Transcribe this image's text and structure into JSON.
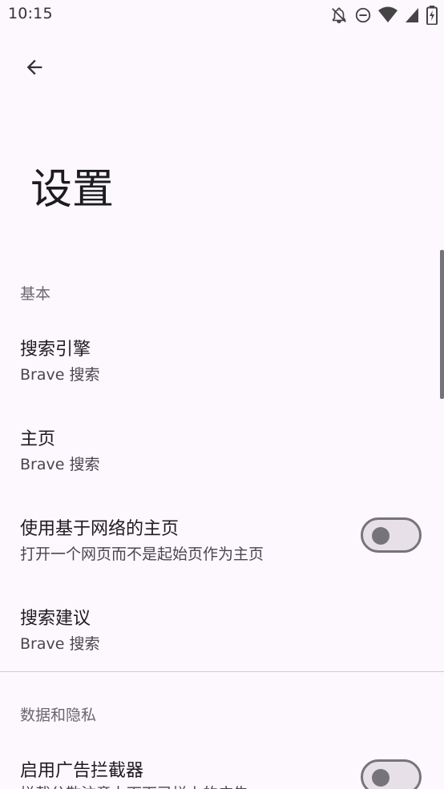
{
  "status_bar": {
    "time": "10:15",
    "icons": [
      "bell-off-icon",
      "do-not-disturb-icon",
      "wifi-icon",
      "cell-signal-icon",
      "battery-charging-icon"
    ]
  },
  "header": {
    "back_icon": "arrow-back-icon",
    "title": "设置"
  },
  "sections": [
    {
      "header": "基本",
      "items": [
        {
          "title": "搜索引擎",
          "summary": "Brave 搜索"
        },
        {
          "title": "主页",
          "summary": "Brave 搜索"
        },
        {
          "title": "使用基于网络的主页",
          "summary": "打开一个网页而不是起始页作为主页",
          "toggle": false
        },
        {
          "title": "搜索建议",
          "summary": "Brave 搜索"
        }
      ]
    },
    {
      "header": "数据和隐私",
      "items": [
        {
          "title": "启用广告拦截器",
          "summary": "拦截分散注意力下面已拦上的广告",
          "toggle": false
        }
      ]
    }
  ],
  "colors": {
    "background": "#fdf7fe",
    "toggle_off_track": "#e8e0e9",
    "toggle_off_border": "#77737a"
  }
}
